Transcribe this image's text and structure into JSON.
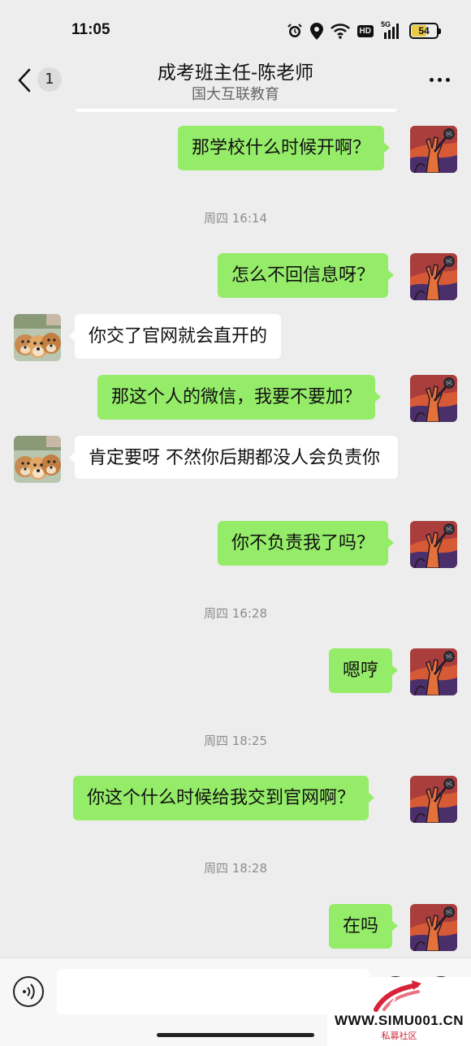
{
  "status_bar": {
    "time": "11:05",
    "icons": [
      "alarm-icon",
      "location-icon",
      "wifi-icon",
      "hd-icon",
      "signal-5g-icon",
      "battery-icon"
    ],
    "hd_label": "HD",
    "network_label": "5G",
    "battery_level": "54"
  },
  "header": {
    "unread_count": "1",
    "title": "成考班主任-陈老师",
    "subtitle": "国大互联教育"
  },
  "messages": [
    {
      "type": "sent",
      "text": "那学校什么时候开啊？"
    },
    {
      "type": "timestamp",
      "text": "周四 16:14"
    },
    {
      "type": "sent",
      "text": "怎么不回信息呀？"
    },
    {
      "type": "received",
      "text": "你交了官网就会直开的"
    },
    {
      "type": "sent",
      "text": "那这个人的微信，我要不要加？"
    },
    {
      "type": "received",
      "text": "肯定要呀 不然你后期都没人会负责你"
    },
    {
      "type": "sent",
      "text": "你不负责我了吗？"
    },
    {
      "type": "timestamp",
      "text": "周四 16:28"
    },
    {
      "type": "sent",
      "text": "嗯哼"
    },
    {
      "type": "timestamp",
      "text": "周四 18:25"
    },
    {
      "type": "sent",
      "text": "你这个什么时候给我交到官网啊？"
    },
    {
      "type": "timestamp",
      "text": "周四 18:28"
    },
    {
      "type": "sent",
      "text": "在吗"
    }
  ],
  "input_bar": {
    "placeholder": ""
  },
  "watermark": {
    "text": "WWW.SIMU001.CN",
    "subtext": "私募社区"
  },
  "colors": {
    "background": "#ededed",
    "sent_bubble": "#95ec69",
    "received_bubble": "#ffffff",
    "timestamp": "#8d8d8d"
  }
}
